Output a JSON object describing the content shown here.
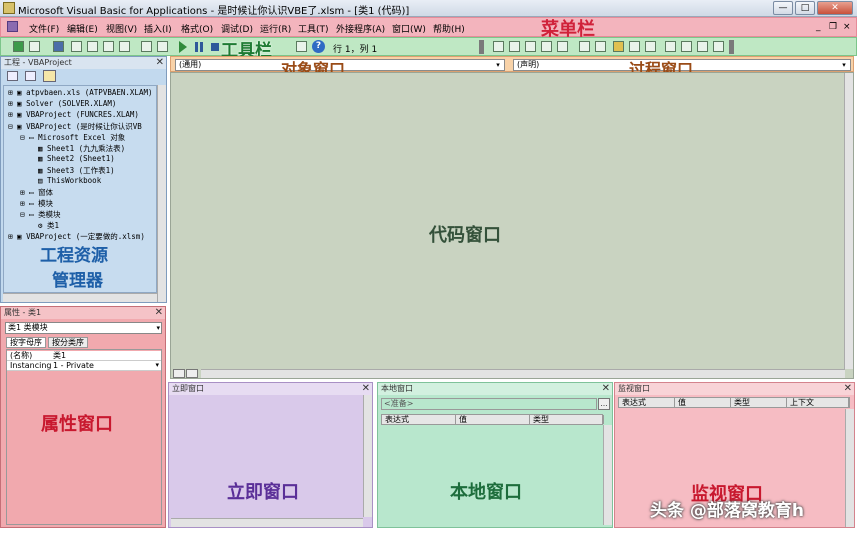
{
  "window": {
    "title": "Microsoft Visual Basic for Applications - 是时候让你认识VBE了.xlsm - [类1 (代码)]",
    "min": "—",
    "max": "□",
    "close": "✕"
  },
  "menu": {
    "items": [
      "文件(F)",
      "编辑(E)",
      "视图(V)",
      "插入(I)",
      "格式(O)",
      "调试(D)",
      "运行(R)",
      "工具(T)",
      "外接程序(A)",
      "窗口(W)",
      "帮助(H)"
    ],
    "annotation": "菜单栏",
    "mdi_controls": [
      "_",
      "❐",
      "×"
    ]
  },
  "toolbar": {
    "annotation": "工具栏",
    "position": "行 1，列 1"
  },
  "objectbar": {
    "object_value": "(通用)",
    "procedure_value": "(声明)",
    "object_annotation": "对象窗口",
    "procedure_annotation": "过程窗口"
  },
  "project": {
    "header": "工程 - VBAProject",
    "annotation_line1": "工程资源",
    "annotation_line2": "管理器",
    "tree": [
      "atpvbaen.xls (ATPVBAEN.XLAM)",
      "Solver (SOLVER.XLAM)",
      "VBAProject (FUNCRES.XLAM)",
      "VBAProject (是时候让你认识VB",
      "Microsoft Excel 对象",
      "Sheet1 (九九乘法表)",
      "Sheet2 (Sheet1)",
      "Sheet3 (工作表1)",
      "ThisWorkbook",
      "窗体",
      "模块",
      "类模块",
      "类1",
      "VBAProject (一定要做的.xlsm)"
    ]
  },
  "properties": {
    "header": "属性 - 类1",
    "combo": "类1 类模块",
    "tab_alpha": "按字母序",
    "tab_category": "按分类序",
    "rows": [
      {
        "name": "(名称)",
        "value": "类1"
      },
      {
        "name": "Instancing",
        "value": "1 - Private"
      }
    ],
    "annotation": "属性窗口"
  },
  "code": {
    "annotation": "代码窗口"
  },
  "immediate": {
    "header": "立即窗口",
    "annotation": "立即窗口"
  },
  "locals": {
    "header": "本地窗口",
    "status": "<准备>",
    "columns": [
      "表达式",
      "值",
      "类型"
    ],
    "annotation": "本地窗口"
  },
  "watch": {
    "header": "监视窗口",
    "columns": [
      "表达式",
      "值",
      "类型",
      "上下文"
    ],
    "annotation": "监视窗口"
  },
  "watermark": "头条 @部落窝教育h"
}
